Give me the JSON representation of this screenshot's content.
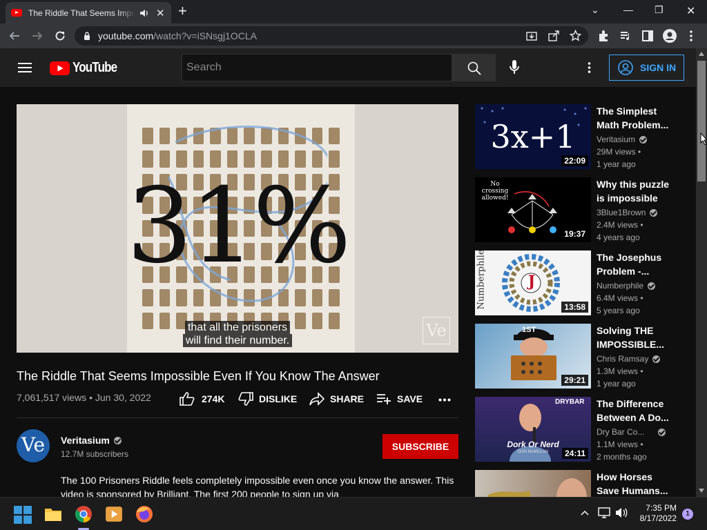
{
  "browser": {
    "tab_title": "The Riddle That Seems Impossible Even If You Know The Answer",
    "url_host": "youtube.com",
    "url_path": "/watch?v=iSNsgj1OCLA"
  },
  "header": {
    "logo_text": "YouTube",
    "search_placeholder": "Search",
    "sign_in_label": "SIGN IN"
  },
  "player": {
    "overlay_text": "31%",
    "caption_line1": "that all the prisoners",
    "caption_line2": "will find their number.",
    "watermark": "Ve"
  },
  "video": {
    "title": "The Riddle That Seems Impossible Even If You Know The Answer",
    "meta": "7,061,517 views • Jun 30, 2022",
    "likes": "274K",
    "dislike_label": "DISLIKE",
    "share_label": "SHARE",
    "save_label": "SAVE"
  },
  "channel": {
    "avatar_text": "Ve",
    "name": "Veritasium",
    "subscribers": "12.7M subscribers",
    "subscribe_label": "SUBSCRIBE",
    "description": "The 100 Prisoners Riddle feels completely impossible even once you know the answer. This video is sponsored by Brilliant. The first 200 people to sign up via"
  },
  "related": [
    {
      "title": "The Simplest Math Problem...",
      "channel": "Veritasium",
      "views": "29M views •",
      "age": "1 year ago",
      "duration": "22:09",
      "thumb_text": "3x+1"
    },
    {
      "title": "Why this puzzle is impossible",
      "channel": "3Blue1Brown",
      "views": "2.4M views •",
      "age": "4 years ago",
      "duration": "19:37",
      "thumb_text": "No crossing allowed!"
    },
    {
      "title": "The Josephus Problem -...",
      "channel": "Numberphile",
      "views": "6.4M views •",
      "age": "5 years ago",
      "duration": "13:58",
      "thumb_text": "Numberphile",
      "thumb_letter": "J"
    },
    {
      "title": "Solving THE IMPOSSIBLE...",
      "channel": "Chris Ramsay",
      "views": "1.3M views •",
      "age": "1 year ago",
      "duration": "29:21",
      "thumb_text": "1ST"
    },
    {
      "title": "The Difference Between A Do...",
      "channel": "Dry Bar Co...",
      "views": "1.1M views •",
      "age": "2 months ago",
      "duration": "24:11",
      "thumb_text": "Dork Or Nerd",
      "thumb_sub": "DON McMILLAN",
      "thumb_brand": "DRYBAR"
    },
    {
      "title": "How Horses Save Humans...",
      "channel": "",
      "views": "",
      "age": "",
      "duration": ""
    }
  ],
  "taskbar": {
    "time": "7:35 PM",
    "date": "8/17/2022",
    "notification_count": "1"
  },
  "colors": {
    "accent_red": "#ff0000",
    "link_blue": "#3ea6ff",
    "subscribe_red": "#cc0000"
  }
}
